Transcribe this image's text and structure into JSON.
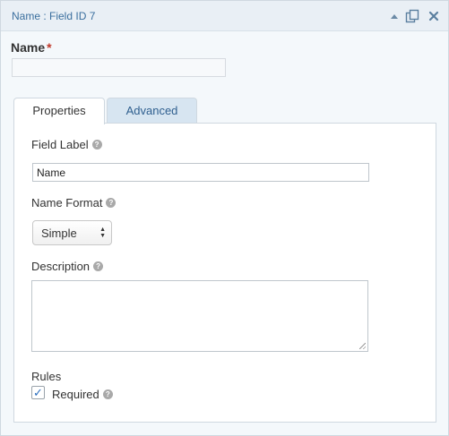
{
  "header": {
    "title": "Name : Field ID 7",
    "icons": [
      "collapse-arrow-icon",
      "duplicate-icon",
      "delete-icon"
    ]
  },
  "field_preview": {
    "label": "Name",
    "required_marker": "*"
  },
  "tabs": [
    {
      "label": "Properties",
      "active": true
    },
    {
      "label": "Advanced",
      "active": false
    }
  ],
  "properties": {
    "field_label": {
      "label": "Field Label",
      "value": "Name"
    },
    "name_format": {
      "label": "Name Format",
      "selected": "Simple"
    },
    "description": {
      "label": "Description",
      "value": ""
    },
    "rules": {
      "label": "Rules",
      "required_label": "Required",
      "required_checked": true
    }
  },
  "help_glyph": "?",
  "colors": {
    "header_text": "#3b6f9e",
    "required": "#c0392b",
    "tab_inactive_bg": "#d7e5f1",
    "checkbox_check": "#2a6ebd"
  }
}
